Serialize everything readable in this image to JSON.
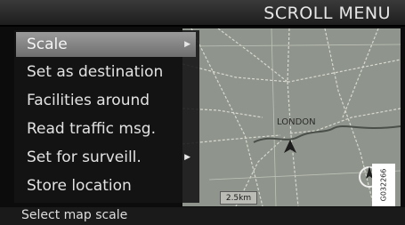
{
  "header": {
    "title": "SCROLL MENU"
  },
  "menu": {
    "items": [
      {
        "label": "Scale",
        "has_submenu": true,
        "selected": true
      },
      {
        "label": "Set as destination",
        "has_submenu": false,
        "selected": false
      },
      {
        "label": "Facilities around",
        "has_submenu": false,
        "selected": false
      },
      {
        "label": "Read traffic msg.",
        "has_submenu": false,
        "selected": false
      },
      {
        "label": "Set for surveill.",
        "has_submenu": true,
        "selected": false
      },
      {
        "label": "Store location",
        "has_submenu": false,
        "selected": false
      }
    ],
    "submenu_glyph": "▶"
  },
  "map": {
    "city_label": "LONDON",
    "scale_label": "2.5km"
  },
  "status": {
    "text": "Select map scale"
  },
  "figure_code": "G032266",
  "colors": {
    "background": "#0c0c0c",
    "highlight": "#8a8a8a",
    "map": "#8f958c",
    "text": "#e2e2e2"
  }
}
